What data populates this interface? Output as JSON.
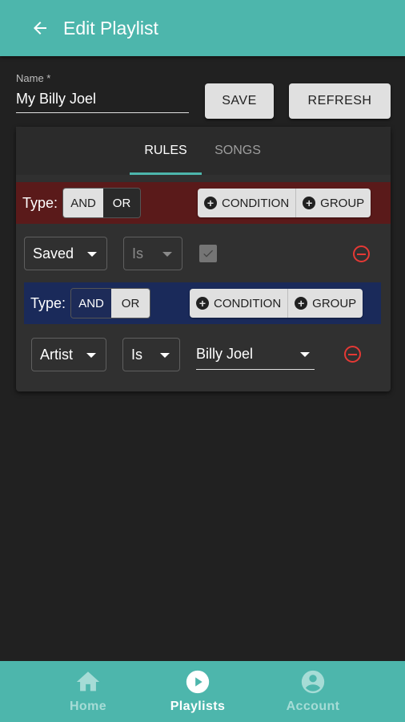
{
  "app_bar": {
    "title": "Edit Playlist",
    "back_icon": "arrow-left-icon"
  },
  "name_field": {
    "label": "Name *",
    "value": "My Billy Joel"
  },
  "actions": {
    "save_label": "SAVE",
    "refresh_label": "REFRESH"
  },
  "tabs": [
    {
      "label": "RULES",
      "selected": true
    },
    {
      "label": "SONGS",
      "selected": false
    }
  ],
  "outer_group": {
    "type_label": "Type:",
    "options": [
      "AND",
      "OR"
    ],
    "selected": "AND",
    "add_condition_label": "CONDITION",
    "add_group_label": "GROUP",
    "color": "#5a1a1a",
    "condition": {
      "field": "Saved",
      "operator": "Is",
      "checked": true
    }
  },
  "inner_group": {
    "type_label": "Type:",
    "options": [
      "AND",
      "OR"
    ],
    "selected": "OR",
    "add_condition_label": "CONDITION",
    "add_group_label": "GROUP",
    "color": "#1a2a5a",
    "condition": {
      "field": "Artist",
      "operator": "Is",
      "value": "Billy Joel"
    }
  },
  "bottom_nav": [
    {
      "label": "Home",
      "icon": "home-icon",
      "active": false
    },
    {
      "label": "Playlists",
      "icon": "play-circle-icon",
      "active": true
    },
    {
      "label": "Account",
      "icon": "account-circle-icon",
      "active": false
    }
  ],
  "colors": {
    "accent": "#4db6ac",
    "danger": "#e53935",
    "background": "#212121"
  }
}
